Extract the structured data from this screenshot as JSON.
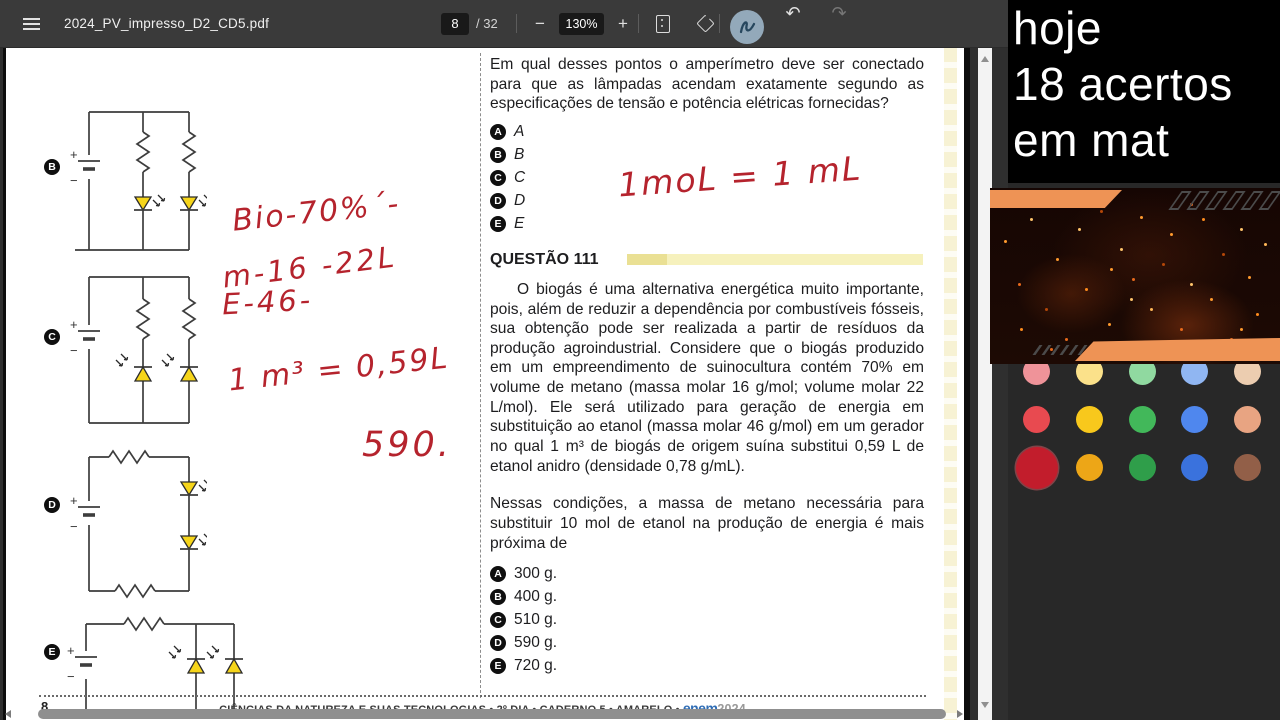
{
  "toolbar": {
    "title": "2024_PV_impresso_D2_CD5.pdf",
    "page_current": "8",
    "page_total": "/ 32",
    "zoom_out_label": "−",
    "zoom_level": "130%",
    "zoom_in_label": "+",
    "undo_icon": "↶",
    "redo_icon": "↷",
    "pen_highlight_color": "#93a9ba"
  },
  "exam": {
    "symbols": {
      "plus": "+",
      "minus": "−"
    },
    "circuit_labels": [
      "B",
      "C",
      "D",
      "E"
    ],
    "question_110": {
      "stem": "Em qual desses pontos o amperímetro deve ser conectado para que as lâmpadas acendam exatamente segundo as especificações de tensão e potência elétricas fornecidas?",
      "options": [
        {
          "letter": "A",
          "text": "A"
        },
        {
          "letter": "B",
          "text": "B"
        },
        {
          "letter": "C",
          "text": "C"
        },
        {
          "letter": "D",
          "text": "D"
        },
        {
          "letter": "E",
          "text": "E"
        }
      ]
    },
    "question_111": {
      "heading": "QUESTÃO 111",
      "paragraph_1": "O biogás é uma alternativa energética muito importante, pois, além de reduzir a dependência por combustíveis fósseis, sua obtenção pode ser realizada a partir de resíduos da produção agroindustrial. Considere que o biogás produzido em um empreendimento de suinocultura contém 70% em volume de metano (massa molar 16 g/mol; volume molar 22 L/mol). Ele será utilizado para geração de energia em substituição ao etanol (massa molar 46 g/mol) em um gerador no qual 1 m³ de biogás de origem suína substitui 0,59 L de etanol anidro (densidade 0,78 g/mL).",
      "paragraph_2": "Nessas condições, a massa de metano necessária para substituir 10 mol de etanol na produção de energia é mais próxima de",
      "options": [
        {
          "letter": "A",
          "text": "300 g."
        },
        {
          "letter": "B",
          "text": "400 g."
        },
        {
          "letter": "C",
          "text": "510 g."
        },
        {
          "letter": "D",
          "text": "590 g."
        },
        {
          "letter": "E",
          "text": "720 g."
        }
      ]
    },
    "footer": {
      "page_number": "8",
      "strip_text": "CIÊNCIAS DA NATUREZA E SUAS TECNOLOGIAS • 2º DIA • CADERNO 5 • AMARELO • ",
      "brand": "enem",
      "brand_year": "2024"
    }
  },
  "ink": {
    "color": "#b5232d",
    "notes": [
      {
        "text": "Bio-70%´-"
      },
      {
        "text": "m-16 -22L"
      },
      {
        "text": "E-46-"
      },
      {
        "text": "1 m³ = 0,59L"
      },
      {
        "text": "590."
      },
      {
        "text": "1moL = 1 mL"
      }
    ]
  },
  "overlay": {
    "score_text": {
      "line1": "hoje",
      "line2": "18 acertos",
      "line3": "em mat"
    },
    "accent_orange": "#ee9355",
    "palette": {
      "selected_color": "#c21d2c",
      "rows": [
        [
          "#ef9399",
          "#fbe18a",
          "#90d9a0",
          "#90b6f2",
          "#eccdb0"
        ],
        [
          "#e84a50",
          "#f8c81c",
          "#42b85a",
          "#4f87ee",
          "#e8a482"
        ],
        [
          "#c21d2c",
          "#eda617",
          "#2f9e4a",
          "#3a72dd",
          "#925f48"
        ]
      ]
    }
  }
}
